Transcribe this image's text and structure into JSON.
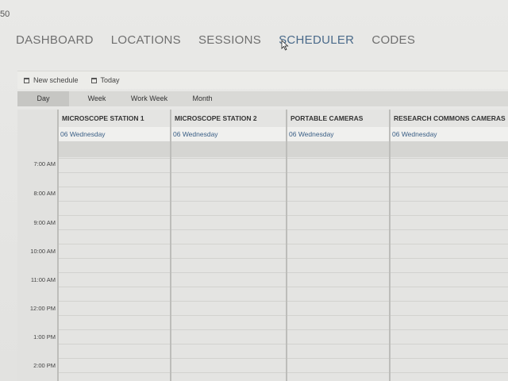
{
  "corner_text": "50",
  "nav": {
    "items": [
      {
        "label": "DASHBOARD",
        "active": false
      },
      {
        "label": "LOCATIONS",
        "active": false
      },
      {
        "label": "SESSIONS",
        "active": false
      },
      {
        "label": "SCHEDULER",
        "active": true
      },
      {
        "label": "CODES",
        "active": false
      }
    ]
  },
  "toolbar": {
    "new_schedule_label": "New schedule",
    "today_label": "Today"
  },
  "views": {
    "tabs": [
      {
        "label": "Day",
        "active": true
      },
      {
        "label": "Week",
        "active": false
      },
      {
        "label": "Work Week",
        "active": false
      },
      {
        "label": "Month",
        "active": false
      }
    ]
  },
  "scheduler": {
    "resources": [
      {
        "name": "MICROSCOPE STATION 1",
        "date": "06 Wednesday"
      },
      {
        "name": "MICROSCOPE STATION 2",
        "date": "06 Wednesday"
      },
      {
        "name": "PORTABLE CAMERAS",
        "date": "06 Wednesday"
      },
      {
        "name": "RESEARCH COMMONS CAMERAS",
        "date": "06 Wednesday"
      }
    ],
    "times": [
      "7:00 AM",
      "8:00 AM",
      "9:00 AM",
      "10:00 AM",
      "11:00 AM",
      "12:00 PM",
      "1:00 PM",
      "2:00 PM"
    ]
  },
  "colors": {
    "accent": "#4a6a8a",
    "date_link": "#3a5f86",
    "background": "#e6e6e4"
  }
}
